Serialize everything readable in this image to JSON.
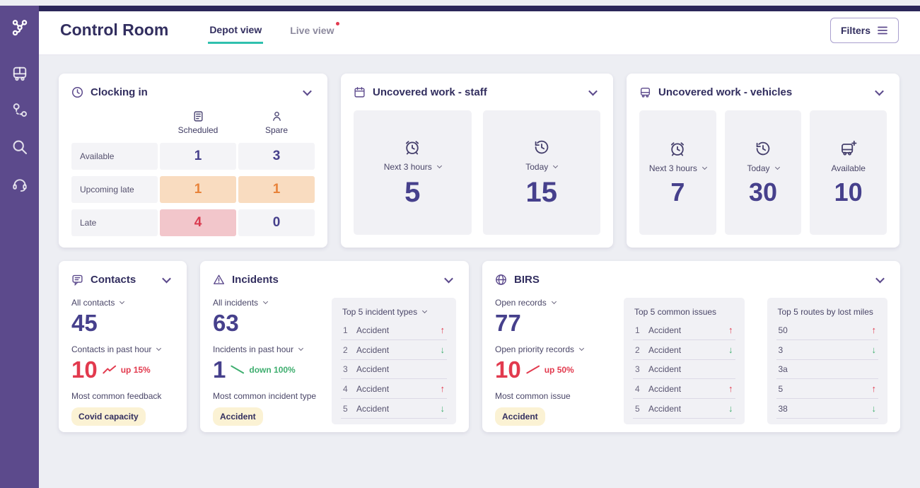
{
  "colors": {
    "sidebar": "#5c4a8c",
    "top_strip": "#2b2659",
    "accent_teal": "#2fc0ae",
    "navy_text": "#322e5f",
    "number_indigo": "#46408c",
    "red": "#e23a4e",
    "orange": "#e8833a",
    "green": "#3fae6f",
    "badge_yellow": "#fbf2d4",
    "highlight_orange_bg": "#f9dcc0",
    "highlight_red_bg": "#f2c6cb"
  },
  "sidebar": {
    "icons": [
      "network-logo",
      "bus",
      "route",
      "search",
      "headset"
    ]
  },
  "header": {
    "title": "Control Room",
    "tabs": [
      {
        "label": "Depot view",
        "active": true
      },
      {
        "label": "Live view",
        "active": false,
        "notification": true
      }
    ],
    "filters_label": "Filters"
  },
  "clocking_in": {
    "title": "Clocking in",
    "columns": [
      {
        "label": "Scheduled",
        "icon": "schedule"
      },
      {
        "label": "Spare",
        "icon": "person"
      }
    ],
    "rows": [
      {
        "label": "Available",
        "scheduled": "1",
        "spare": "3",
        "highlight": "none"
      },
      {
        "label": "Upcoming late",
        "scheduled": "1",
        "spare": "1",
        "highlight": "orange"
      },
      {
        "label": "Late",
        "scheduled": "4",
        "spare": "0",
        "highlight": "red"
      }
    ]
  },
  "uncovered_staff": {
    "title": "Uncovered work - staff",
    "panels": [
      {
        "label": "Next 3 hours",
        "value": "5",
        "icon": "alarm",
        "dropdown": true
      },
      {
        "label": "Today",
        "value": "15",
        "icon": "history",
        "dropdown": true
      }
    ]
  },
  "uncovered_vehicles": {
    "title": "Uncovered work - vehicles",
    "panels": [
      {
        "label": "Next 3 hours",
        "value": "7",
        "icon": "alarm",
        "dropdown": true
      },
      {
        "label": "Today",
        "value": "30",
        "icon": "history",
        "dropdown": true
      },
      {
        "label": "Available",
        "value": "10",
        "icon": "bus-plus",
        "dropdown": false
      }
    ]
  },
  "contacts": {
    "title": "Contacts",
    "stat1_label": "All contacts",
    "stat1_value": "45",
    "stat2_label": "Contacts in past hour",
    "stat2_value": "10",
    "stat2_trend": "up",
    "stat2_trend_text": "up 15%",
    "feedback_label": "Most common feedback",
    "feedback_badge": "Covid capacity"
  },
  "incidents": {
    "title": "Incidents",
    "stat1_label": "All incidents",
    "stat1_value": "63",
    "stat2_label": "Incidents in past hour",
    "stat2_value": "1",
    "stat2_trend": "down",
    "stat2_trend_text": "down 100%",
    "type_label": "Most common incident type",
    "type_badge": "Accident",
    "top": {
      "title": "Top 5 incident types",
      "items": [
        {
          "rank": "1",
          "label": "Accident",
          "trend": "up"
        },
        {
          "rank": "2",
          "label": "Accident",
          "trend": "down"
        },
        {
          "rank": "3",
          "label": "Accident",
          "trend": "none"
        },
        {
          "rank": "4",
          "label": "Accident",
          "trend": "up"
        },
        {
          "rank": "5",
          "label": "Accident",
          "trend": "down"
        }
      ]
    }
  },
  "birs": {
    "title": "BIRS",
    "stat1_label": "Open records",
    "stat1_value": "77",
    "stat2_label": "Open priority records",
    "stat2_value": "10",
    "stat2_trend": "up",
    "stat2_trend_text": "up 50%",
    "issue_label": "Most common issue",
    "issue_badge": "Accident",
    "issues": {
      "title": "Top 5 common issues",
      "items": [
        {
          "rank": "1",
          "label": "Accident",
          "trend": "up"
        },
        {
          "rank": "2",
          "label": "Accident",
          "trend": "down"
        },
        {
          "rank": "3",
          "label": "Accident",
          "trend": "none"
        },
        {
          "rank": "4",
          "label": "Accident",
          "trend": "up"
        },
        {
          "rank": "5",
          "label": "Accident",
          "trend": "down"
        }
      ]
    },
    "routes": {
      "title": "Top 5 routes by lost miles",
      "items": [
        {
          "label": "50",
          "trend": "up"
        },
        {
          "label": "3",
          "trend": "down"
        },
        {
          "label": "3a",
          "trend": "none"
        },
        {
          "label": "5",
          "trend": "up"
        },
        {
          "label": "38",
          "trend": "down"
        }
      ]
    }
  }
}
